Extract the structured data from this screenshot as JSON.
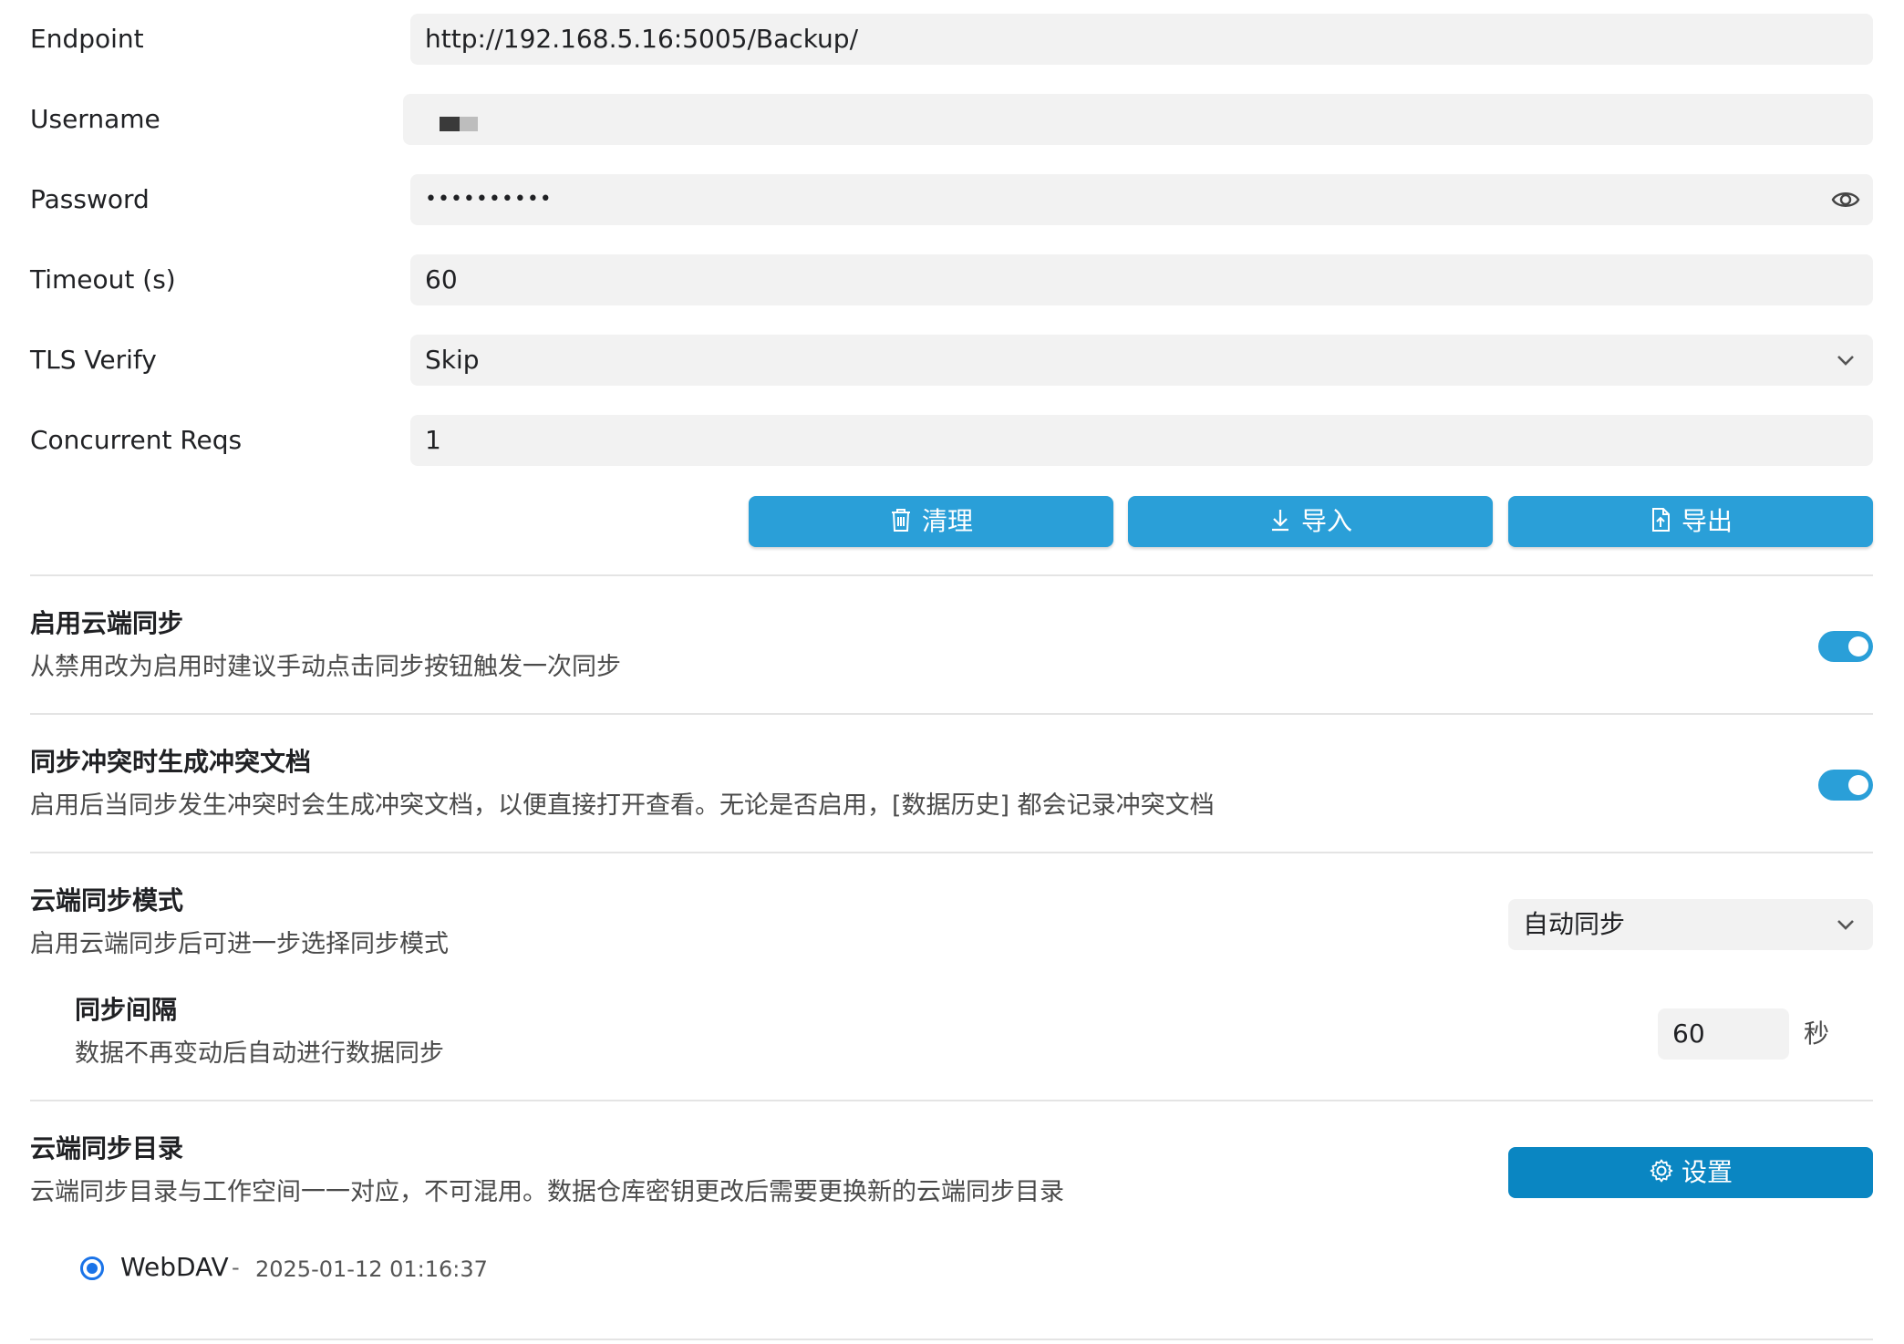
{
  "form": {
    "endpoint": {
      "label": "Endpoint",
      "value": "http://192.168.5.16:5005/Backup/"
    },
    "username": {
      "label": "Username",
      "value": ""
    },
    "password": {
      "label": "Password",
      "value": "••••••••••"
    },
    "timeout": {
      "label": "Timeout (s)",
      "value": "60"
    },
    "tls": {
      "label": "TLS Verify",
      "value": "Skip"
    },
    "concurrent": {
      "label": "Concurrent Reqs",
      "value": "1"
    }
  },
  "actions": {
    "clean_label": "清理",
    "import_label": "导入",
    "export_label": "导出"
  },
  "sections": {
    "cloud_sync": {
      "title": "启用云端同步",
      "desc": "从禁用改为启用时建议手动点击同步按钮触发一次同步",
      "enabled": true
    },
    "conflict_doc": {
      "title": "同步冲突时生成冲突文档",
      "desc": "启用后当同步发生冲突时会生成冲突文档，以便直接打开查看。无论是否启用，[数据历史] 都会记录冲突文档",
      "enabled": true
    },
    "sync_mode": {
      "title": "云端同步模式",
      "desc": "启用云端同步后可进一步选择同步模式",
      "value": "自动同步"
    },
    "sync_interval": {
      "title": "同步间隔",
      "desc": "数据不再变动后自动进行数据同步",
      "value": "60",
      "unit": "秒"
    },
    "sync_dir": {
      "title": "云端同步目录",
      "desc": "云端同步目录与工作空间一一对应，不可混用。数据仓库密钥更改后需要更换新的云端同步目录",
      "button_label": "设置",
      "entry": {
        "name": "WebDAV",
        "separator": "-",
        "time": "2025-01-12 01:16:37",
        "selected": true
      }
    }
  },
  "colors": {
    "accent": "#2a9fd8",
    "settings_button": "#0a86c2",
    "radio": "#1a73e8",
    "field_bg": "#f2f2f2"
  }
}
